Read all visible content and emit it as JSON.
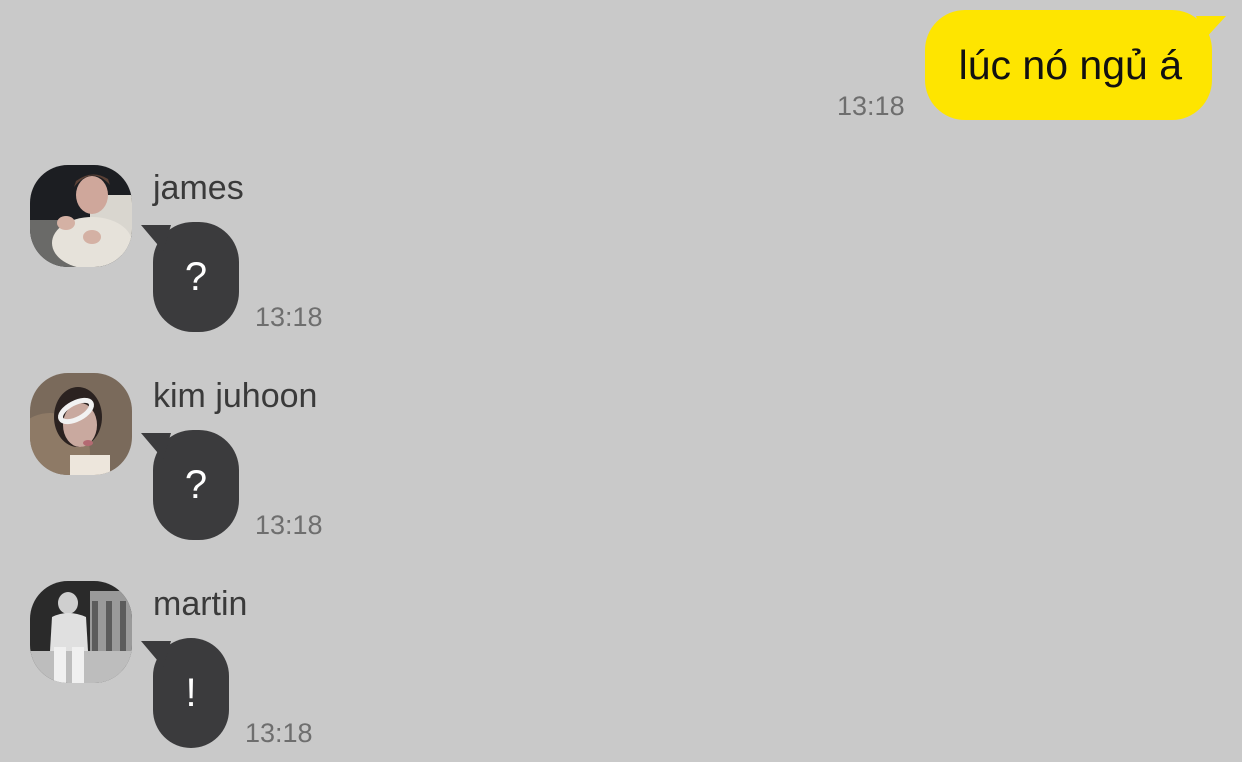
{
  "colors": {
    "background": "#c9c9c9",
    "my_bubble": "#fee500",
    "other_bubble": "#3b3b3d",
    "timestamp": "#6e6e6e"
  },
  "messages": [
    {
      "direction": "outgoing",
      "text": "lúc nó ngủ á",
      "time": "13:18"
    },
    {
      "direction": "incoming",
      "sender": "james",
      "avatar_icon": "profile-photo",
      "text": "?",
      "time": "13:18"
    },
    {
      "direction": "incoming",
      "sender": "kim juhoon",
      "avatar_icon": "profile-photo",
      "text": "?",
      "time": "13:18"
    },
    {
      "direction": "incoming",
      "sender": "martin",
      "avatar_icon": "profile-photo",
      "text": "!",
      "time": "13:18"
    }
  ]
}
